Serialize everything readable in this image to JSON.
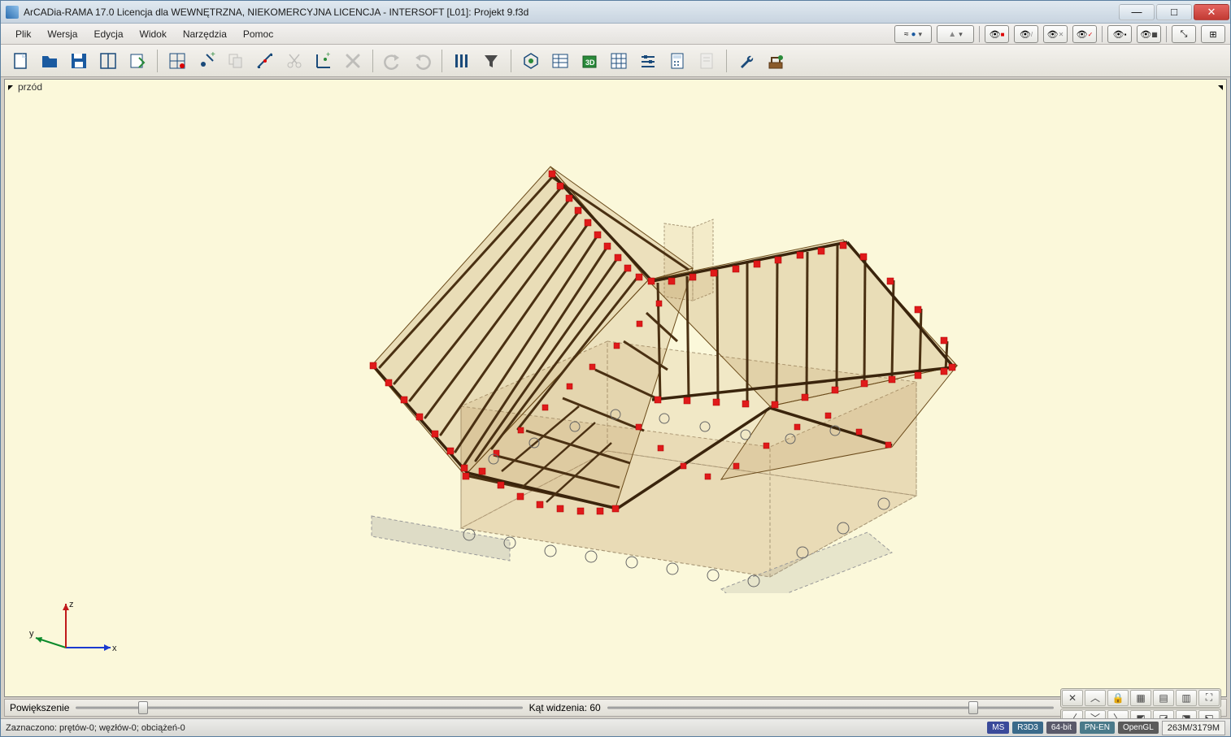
{
  "titlebar": {
    "title": "ArCADia-RAMA 17.0 Licencja dla WEWNĘTRZNA, NIEKOMERCYJNA LICENCJA - INTERSOFT [L01]: Projekt 9.f3d",
    "minimize": "—",
    "maximize": "□",
    "close": "✕"
  },
  "menu": {
    "plik": "Plik",
    "wersja": "Wersja",
    "edycja": "Edycja",
    "widok": "Widok",
    "narzedzia": "Narzędzia",
    "pomoc": "Pomoc"
  },
  "right_tools": {
    "dd1_icon": "≈",
    "dd2_icon": "▲"
  },
  "viewport": {
    "label": "przód"
  },
  "axes": {
    "x": "x",
    "y": "y",
    "z": "z"
  },
  "bottom": {
    "zoom_label": "Powiększenie",
    "angle_label": "Kąt widzenia: 60"
  },
  "status": {
    "selection": "Zaznaczono: prętów-0; węzłów-0; obciążeń-0",
    "ms": "MS",
    "r3": "R3D3",
    "bit": "64-bit",
    "pn": "PN-EN",
    "gl": "OpenGL",
    "mem": "263M/3179M"
  }
}
